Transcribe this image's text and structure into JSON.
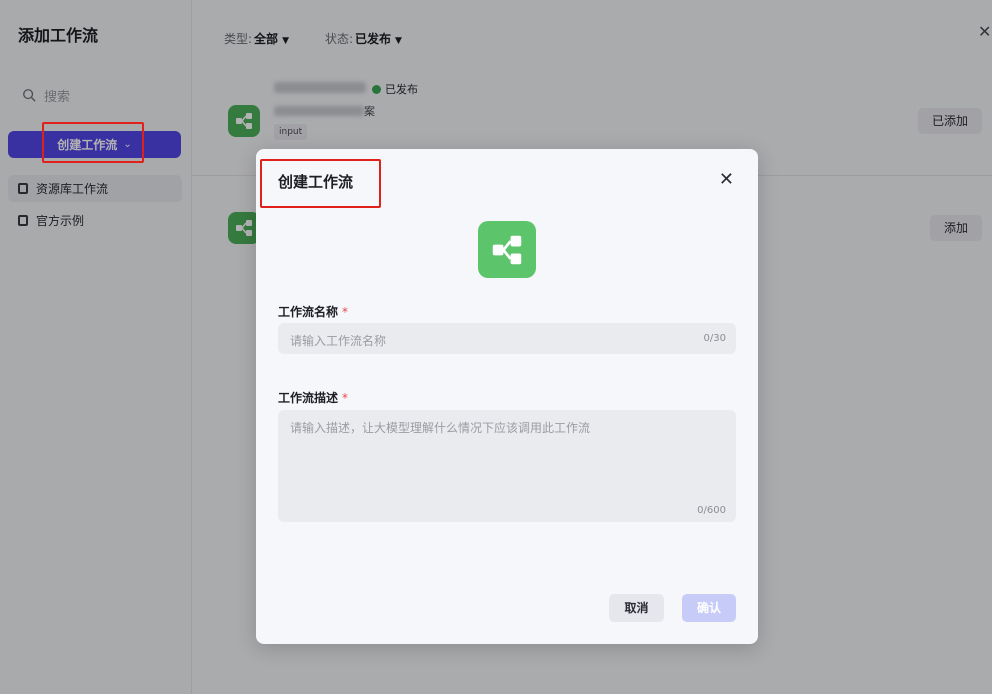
{
  "sidebar": {
    "title": "添加工作流",
    "search_placeholder": "搜索",
    "create_label": "创建工作流",
    "items": [
      {
        "label": "资源库工作流"
      },
      {
        "label": "官方示例"
      }
    ]
  },
  "filters": {
    "type_label": "类型:",
    "type_value": "全部",
    "status_label": "状态:",
    "status_value": "已发布"
  },
  "rows": [
    {
      "status": "已发布",
      "desc_tail": "案",
      "tag": "input",
      "action": "已添加"
    },
    {
      "action": "添加"
    }
  ],
  "modal": {
    "title": "创建工作流",
    "name_label": "工作流名称",
    "name_placeholder": "请输入工作流名称",
    "name_count": "0/30",
    "desc_label": "工作流描述",
    "desc_placeholder": "请输入描述，让大模型理解什么情况下应该调用此工作流",
    "desc_count": "0/600",
    "required_mark": "*",
    "cancel_label": "取消",
    "confirm_label": "确认"
  },
  "colors": {
    "accent": "#5246e8",
    "workflow_icon": "#5cc46a",
    "annotation": "#e0201a"
  }
}
